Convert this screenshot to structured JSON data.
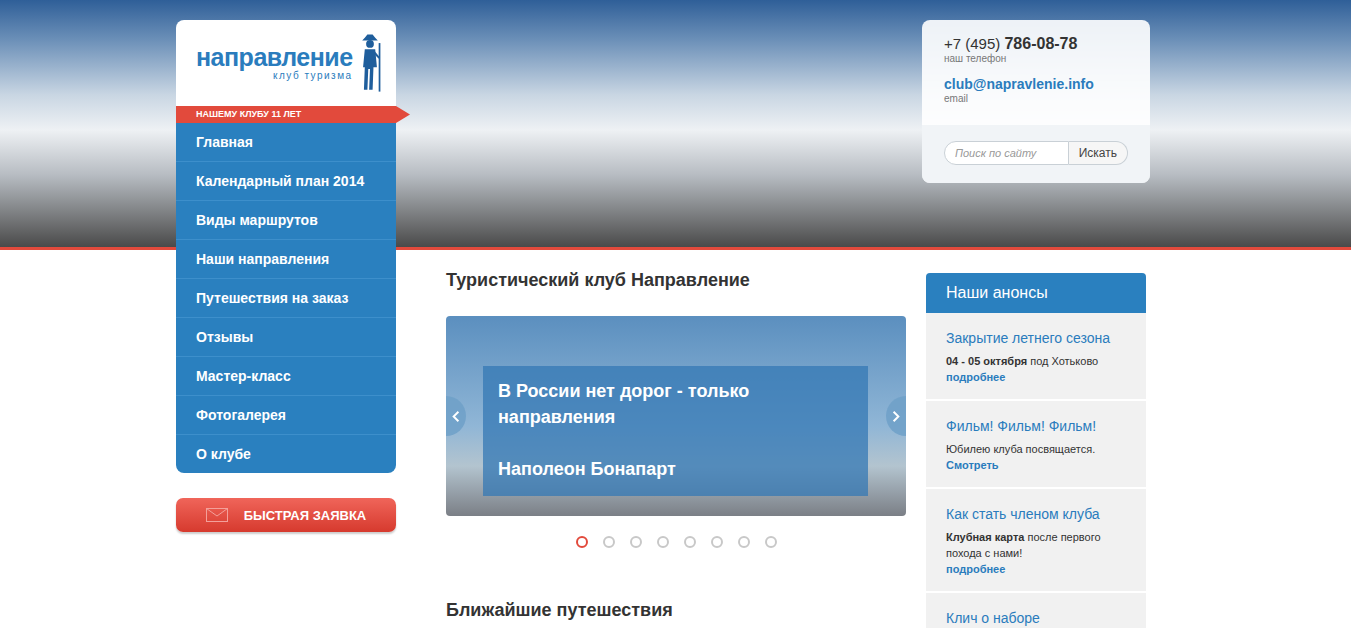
{
  "logo": {
    "name": "направление",
    "tagline": "клуб туризма"
  },
  "anniversary": "НАШЕМУ КЛУБУ 11 ЛЕТ",
  "nav": [
    {
      "label": "Главная",
      "selected": false
    },
    {
      "label": "Календарный план 2014",
      "selected": false
    },
    {
      "label": "Виды маршрутов",
      "selected": false
    },
    {
      "label": "Наши направления",
      "selected": false
    },
    {
      "label": "Путешествия на заказ",
      "selected": false
    },
    {
      "label": "Отзывы",
      "selected": false
    },
    {
      "label": "Мастер-класс",
      "selected": false
    },
    {
      "label": "Фотогалерея",
      "selected": false
    },
    {
      "label": "О клубе",
      "selected": false
    }
  ],
  "quick_request": "БЫСТРАЯ ЗАЯВКА",
  "contact": {
    "phone_code": "+7 (495)",
    "phone_number": "786-08-78",
    "phone_label": "наш телефон",
    "email": "club@napravlenie.info",
    "email_label": "email"
  },
  "search": {
    "placeholder": "Поиск по сайту",
    "button": "Искать"
  },
  "main_title": "Туристический клуб Направление",
  "slider": {
    "quote": "В России нет дорог - только направления",
    "author": "Наполеон Бонапарт",
    "dots": [
      {
        "selected": true
      },
      {
        "selected": false
      },
      {
        "selected": false
      },
      {
        "selected": false
      },
      {
        "selected": false
      },
      {
        "selected": false
      },
      {
        "selected": false
      },
      {
        "selected": false
      }
    ]
  },
  "upcoming_title": "Ближайшие путешествия",
  "announcements": {
    "title": "Наши анонсы",
    "items": [
      {
        "title": "Закрытие летнего сезона",
        "bold": "04 - 05 октября",
        "text": " под Хотьково",
        "link": "подробнее"
      },
      {
        "title": "Фильм! Фильм! Фильм!",
        "bold": "",
        "text": "Юбилею клуба посвящается.",
        "link": "Смотреть"
      },
      {
        "title": "Как стать членом клуба",
        "bold": "Клубная карта",
        "text": " после первого похода с нами!",
        "link": "подробнее"
      },
      {
        "title": "Клич о наборе",
        "bold": "",
        "text": "",
        "link": ""
      }
    ]
  }
}
